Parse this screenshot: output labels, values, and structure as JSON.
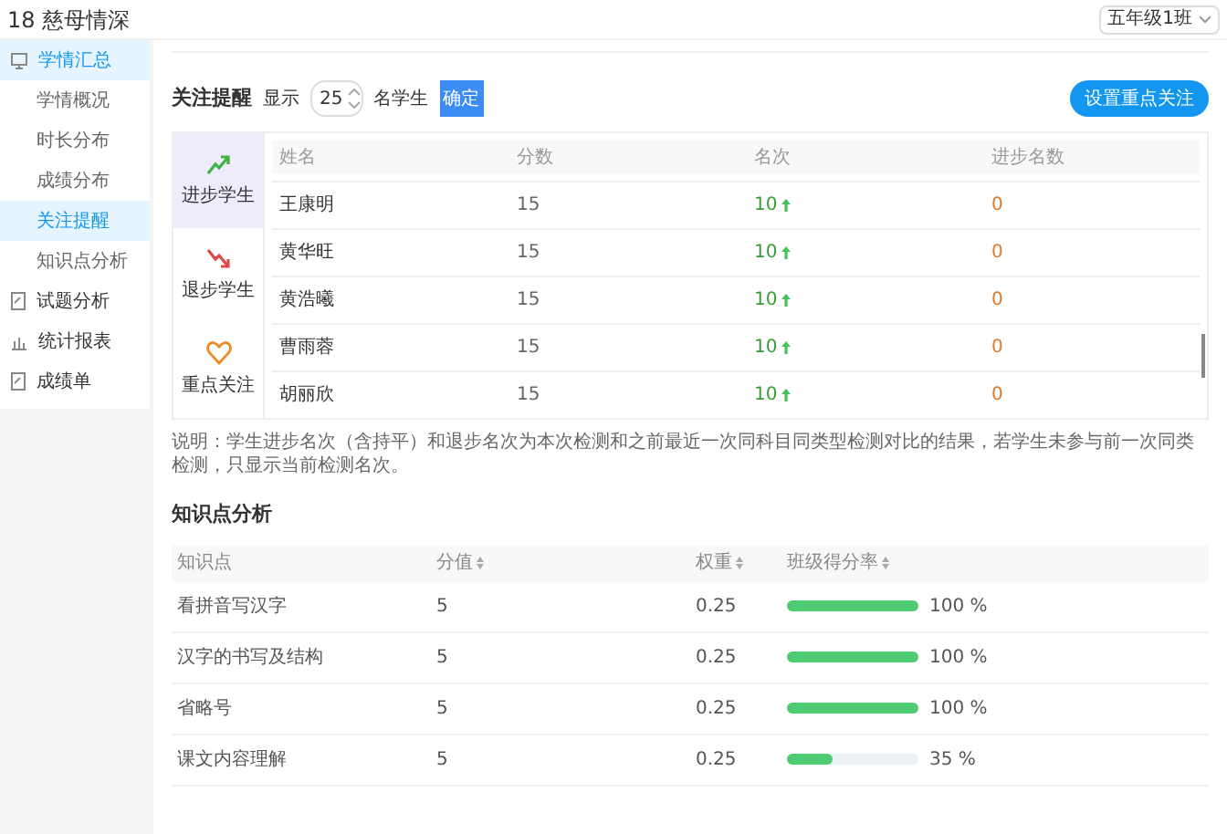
{
  "header": {
    "title": "18 慈母情深",
    "class_select": "五年级1班"
  },
  "sidebar": {
    "items": [
      {
        "label": "学情汇总",
        "kind": "monitor",
        "selected": true,
        "children": [
          {
            "label": "学情概况",
            "selected": false
          },
          {
            "label": "时长分布",
            "selected": false
          },
          {
            "label": "成绩分布",
            "selected": false
          },
          {
            "label": "关注提醒",
            "selected": true
          },
          {
            "label": "知识点分析",
            "selected": false
          }
        ]
      },
      {
        "label": "试题分析",
        "kind": "document",
        "selected": false
      },
      {
        "label": "统计报表",
        "kind": "chart",
        "selected": false
      },
      {
        "label": "成绩单",
        "kind": "document",
        "selected": false
      }
    ]
  },
  "attention": {
    "title": "关注提醒",
    "show_label": "显示",
    "count": "25",
    "unit_label": "名学生",
    "confirm_button": "确定",
    "set_button": "设置重点关注",
    "tabs": [
      {
        "label": "进步学生",
        "kind": "up",
        "selected": true
      },
      {
        "label": "退步学生",
        "kind": "down",
        "selected": false
      },
      {
        "label": "重点关注",
        "kind": "heart",
        "selected": false
      }
    ],
    "table": {
      "columns": [
        "姓名",
        "分数",
        "名次",
        "进步名数"
      ],
      "rows": [
        {
          "name": "王康明",
          "score": "15",
          "rank": "10",
          "kind": "up",
          "progress": "0"
        },
        {
          "name": "黄华旺",
          "score": "15",
          "rank": "10",
          "kind": "up",
          "progress": "0"
        },
        {
          "name": "黄浩曦",
          "score": "15",
          "rank": "10",
          "kind": "up",
          "progress": "0"
        },
        {
          "name": "曹雨蓉",
          "score": "15",
          "rank": "10",
          "kind": "up",
          "progress": "0"
        },
        {
          "name": "胡丽欣",
          "score": "15",
          "rank": "10",
          "kind": "up",
          "progress": "0"
        }
      ]
    },
    "note": "说明：学生进步名次（含持平）和退步名次为本次检测和之前最近一次同科目同类型检测对比的结果，若学生未参与前一次同类检测，只显示当前检测名次。"
  },
  "knowledge": {
    "title": "知识点分析",
    "columns": [
      {
        "label": "知识点",
        "sortable": false
      },
      {
        "label": "分值",
        "sortable": true
      },
      {
        "label": "权重",
        "sortable": true
      },
      {
        "label": "班级得分率",
        "sortable": true
      }
    ],
    "rows": [
      {
        "point": "看拼音写汉字",
        "score": "5",
        "weight": "0.25",
        "level": 1,
        "rate": "100 %"
      },
      {
        "point": "汉字的书写及结构",
        "score": "5",
        "weight": "0.25",
        "level": 1,
        "rate": "100 %"
      },
      {
        "point": "省略号",
        "score": "5",
        "weight": "0.25",
        "level": 1,
        "rate": "100 %"
      },
      {
        "point": "课文内容理解",
        "score": "5",
        "weight": "0.25",
        "level": 0.35,
        "rate": "35 %"
      }
    ]
  }
}
